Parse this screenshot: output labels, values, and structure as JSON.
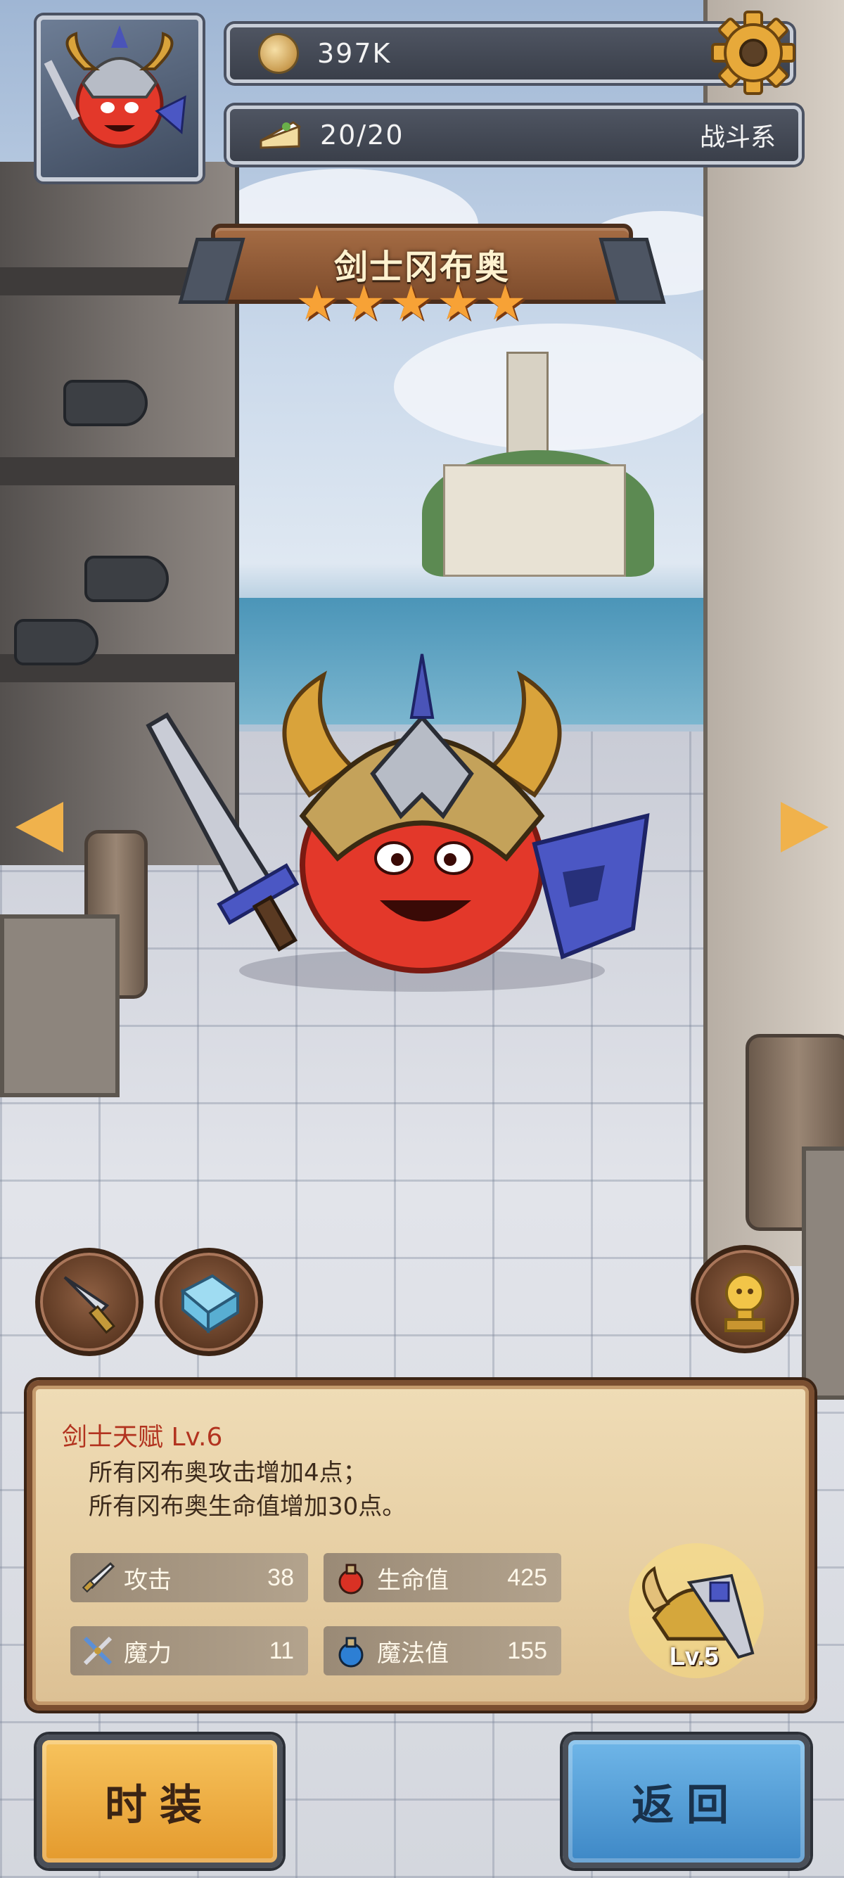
{
  "hud": {
    "coins": "397K",
    "stamina": "20/20",
    "category": "战斗系"
  },
  "hero": {
    "name": "剑士冈布奥",
    "stars": 5
  },
  "talent": {
    "title": "剑士天赋 Lv.6",
    "line1": "所有冈布奥攻击增加4点；",
    "line2": "所有冈布奥生命值增加30点。"
  },
  "stats": {
    "attack": {
      "label": "攻击",
      "value": "38",
      "icon": "sword-icon"
    },
    "magic": {
      "label": "魔力",
      "value": "11",
      "icon": "crossed-swords-icon"
    },
    "hp": {
      "label": "生命值",
      "value": "425",
      "icon": "red-potion-icon"
    },
    "mp": {
      "label": "魔法值",
      "value": "155",
      "icon": "blue-potion-icon"
    }
  },
  "equipment": {
    "level": "Lv.5"
  },
  "buttons": {
    "fashion": "时装",
    "back": "返回"
  },
  "colors": {
    "talent_title": "#b2331f",
    "star": "#f7a236",
    "fashion_button": "#f0b04a",
    "back_button": "#5aa5dc"
  }
}
